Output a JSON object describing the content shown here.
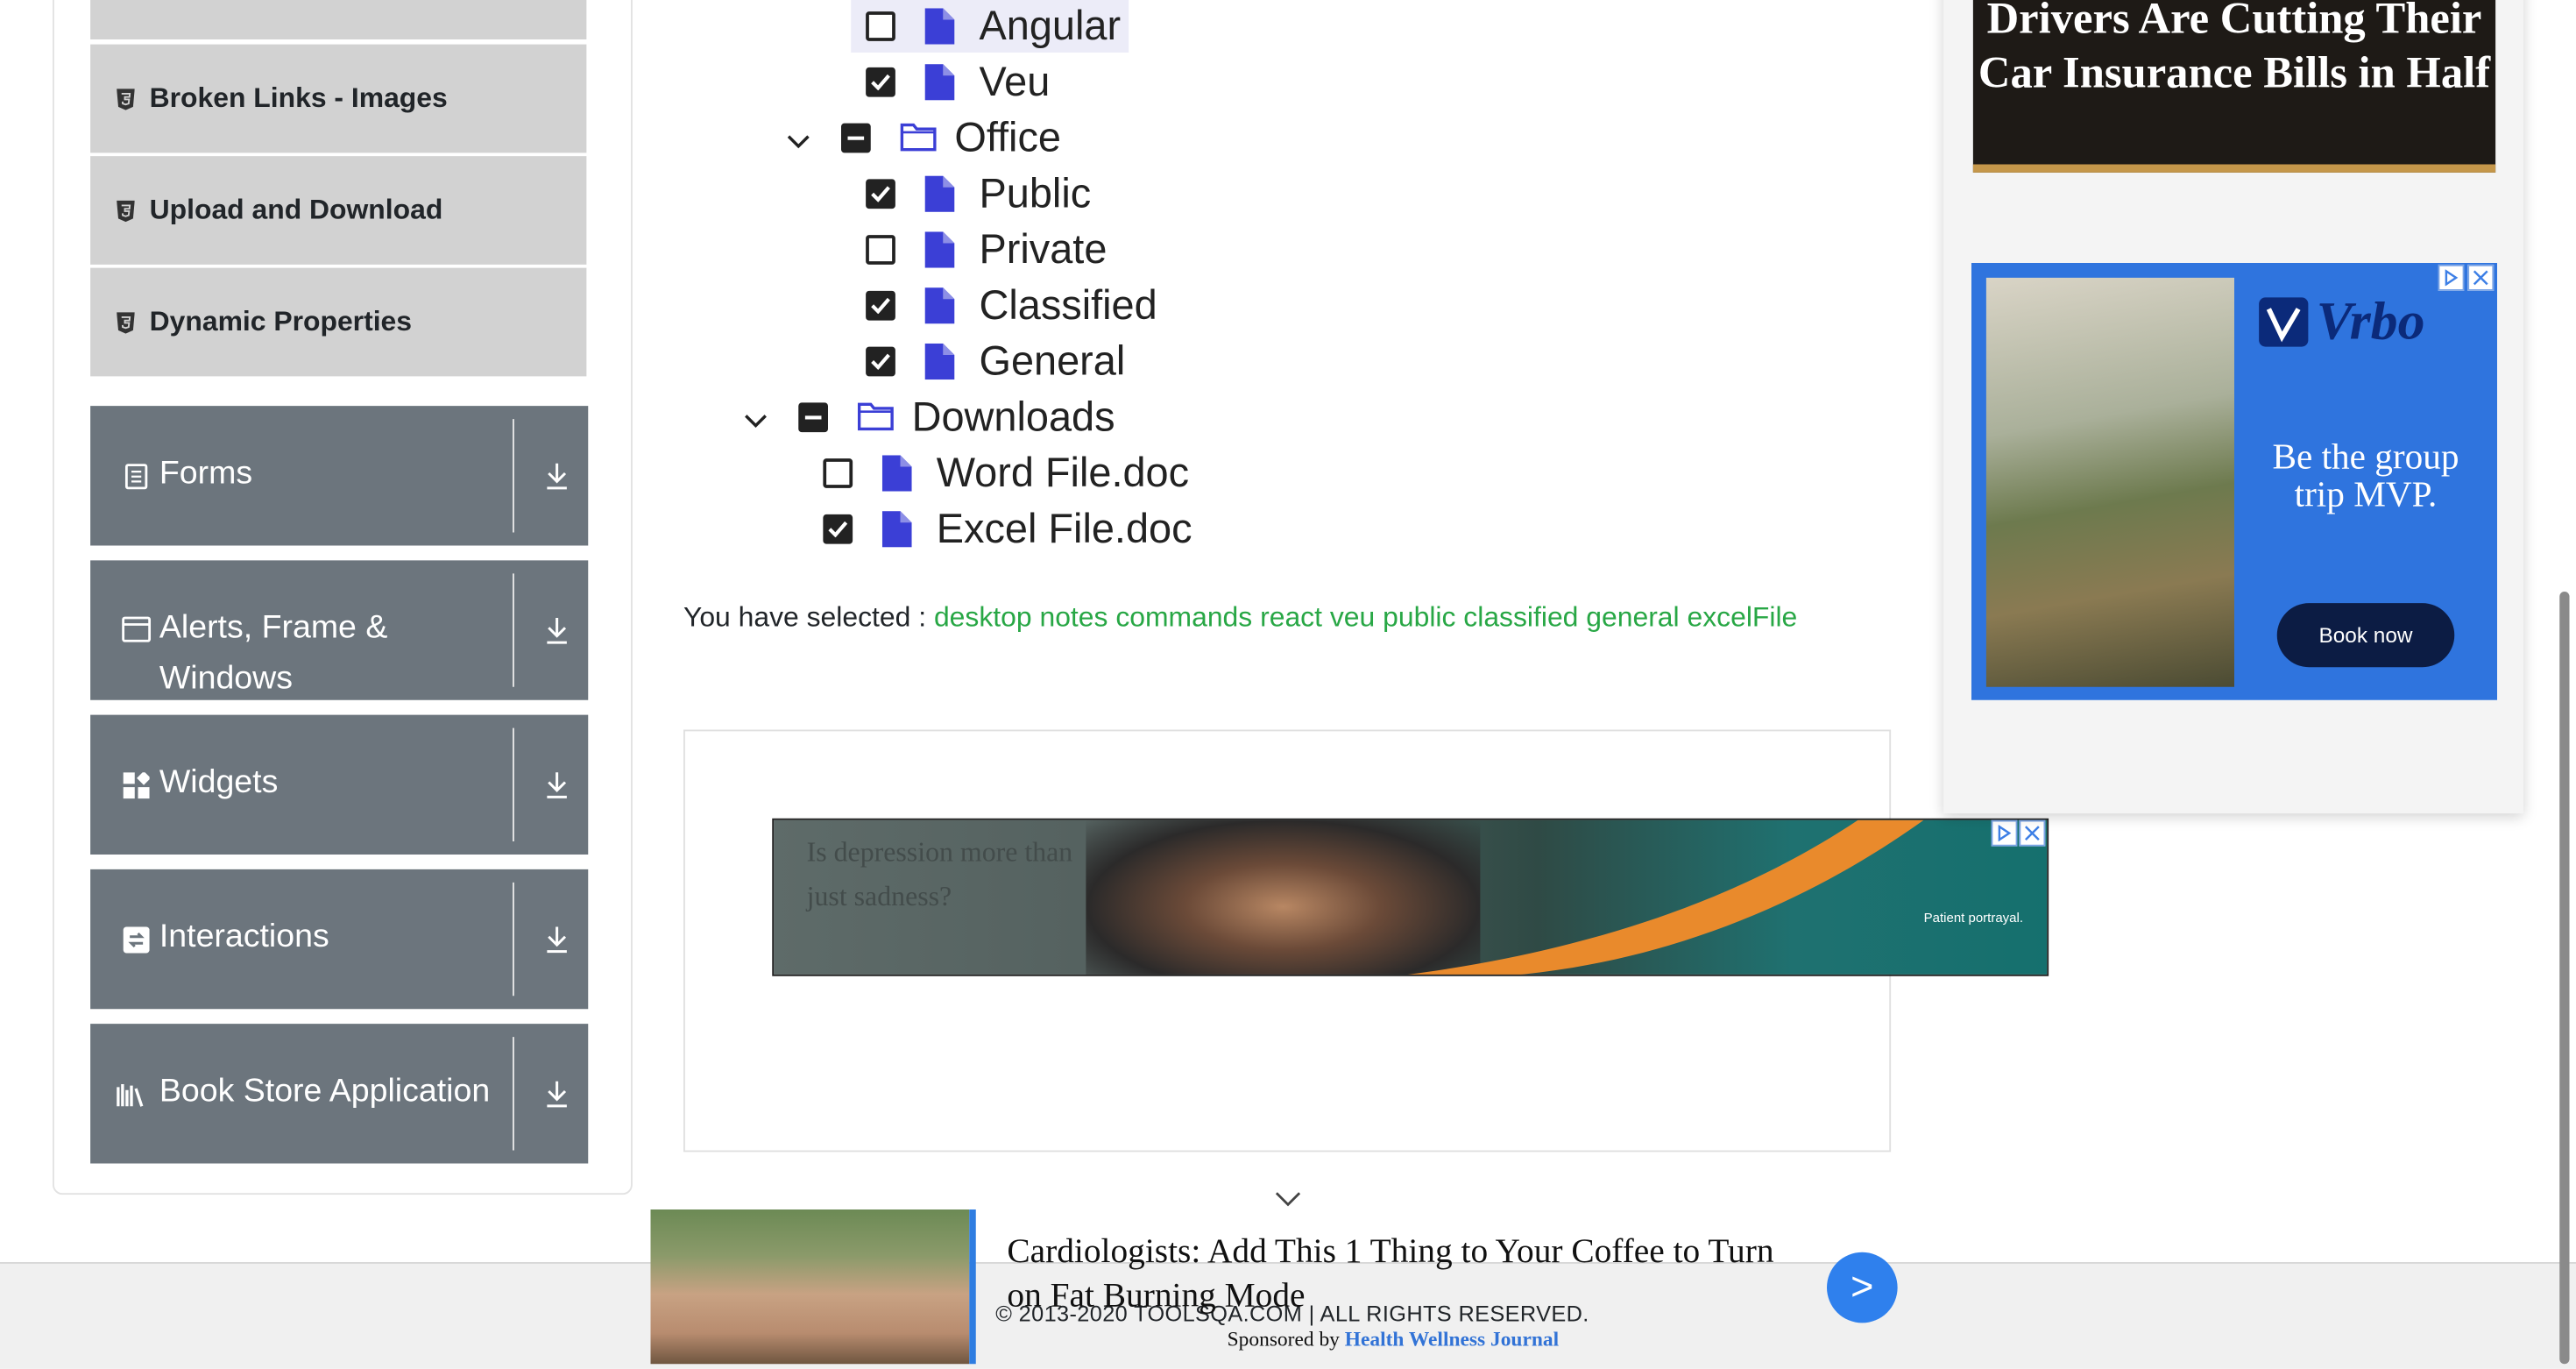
{
  "sidebar": {
    "sub_items": [
      {
        "label": "Broken Links - Images"
      },
      {
        "label": "Upload and Download"
      },
      {
        "label": "Dynamic Properties"
      }
    ],
    "groups": [
      {
        "label_line1": "Forms",
        "label_line2": "",
        "icon": "form-icon"
      },
      {
        "label_line1": "Alerts, Frame &",
        "label_line2": "Windows",
        "icon": "window-icon"
      },
      {
        "label_line1": "Widgets",
        "label_line2": "",
        "icon": "widgets-icon"
      },
      {
        "label_line1": "Interactions",
        "label_line2": "",
        "icon": "interactions-icon"
      },
      {
        "label_line1": "Book Store Application",
        "label_line2": "",
        "icon": "books-icon"
      }
    ]
  },
  "tree": {
    "nodes": [
      {
        "label": "Angular",
        "state": "unchecked",
        "type": "file",
        "highlighted": true
      },
      {
        "label": "Veu",
        "state": "checked",
        "type": "file"
      },
      {
        "label": "Office",
        "state": "partial",
        "type": "folder",
        "expanded": true
      },
      {
        "label": "Public",
        "state": "checked",
        "type": "file"
      },
      {
        "label": "Private",
        "state": "unchecked",
        "type": "file"
      },
      {
        "label": "Classified",
        "state": "checked",
        "type": "file"
      },
      {
        "label": "General",
        "state": "checked",
        "type": "file"
      },
      {
        "label": "Downloads",
        "state": "partial",
        "type": "folder",
        "expanded": true
      },
      {
        "label": "Word File.doc",
        "state": "unchecked",
        "type": "file"
      },
      {
        "label": "Excel File.doc",
        "state": "checked",
        "type": "file"
      }
    ]
  },
  "result": {
    "prefix": "You have selected :",
    "words": [
      "desktop",
      "notes",
      "commands",
      "react",
      "veu",
      "public",
      "classified",
      "general",
      "excelFile"
    ]
  },
  "ads": {
    "insurance_text": "Drivers Are Cutting Their Car Insurance Bills in Half",
    "vrbo_brand": "Vrbo",
    "vrbo_message": "Be the group trip MVP.",
    "vrbo_button": "Book now",
    "depression_text": "Is depression more than just sadness?",
    "depression_note": "Patient portrayal.",
    "footer_ad_headline": "Cardiologists: Add This 1 Thing to Your Coffee to Turn on Fat Burning Mode",
    "footer_ad_sponsor_prefix": "Sponsored by",
    "footer_ad_sponsor": "Health Wellness Journal",
    "footer_ad_go": ">"
  },
  "footer": {
    "copyright": "© 2013-2020 TOOLSQA.COM | ALL RIGHTS RESERVED."
  },
  "colors": {
    "sidebar_group_bg": "#6c757d",
    "sub_item_bg": "#d2d2d2",
    "selected_text": "#28a745",
    "file_icon": "#3b3fd6",
    "folder_icon": "#3b3fd6"
  }
}
